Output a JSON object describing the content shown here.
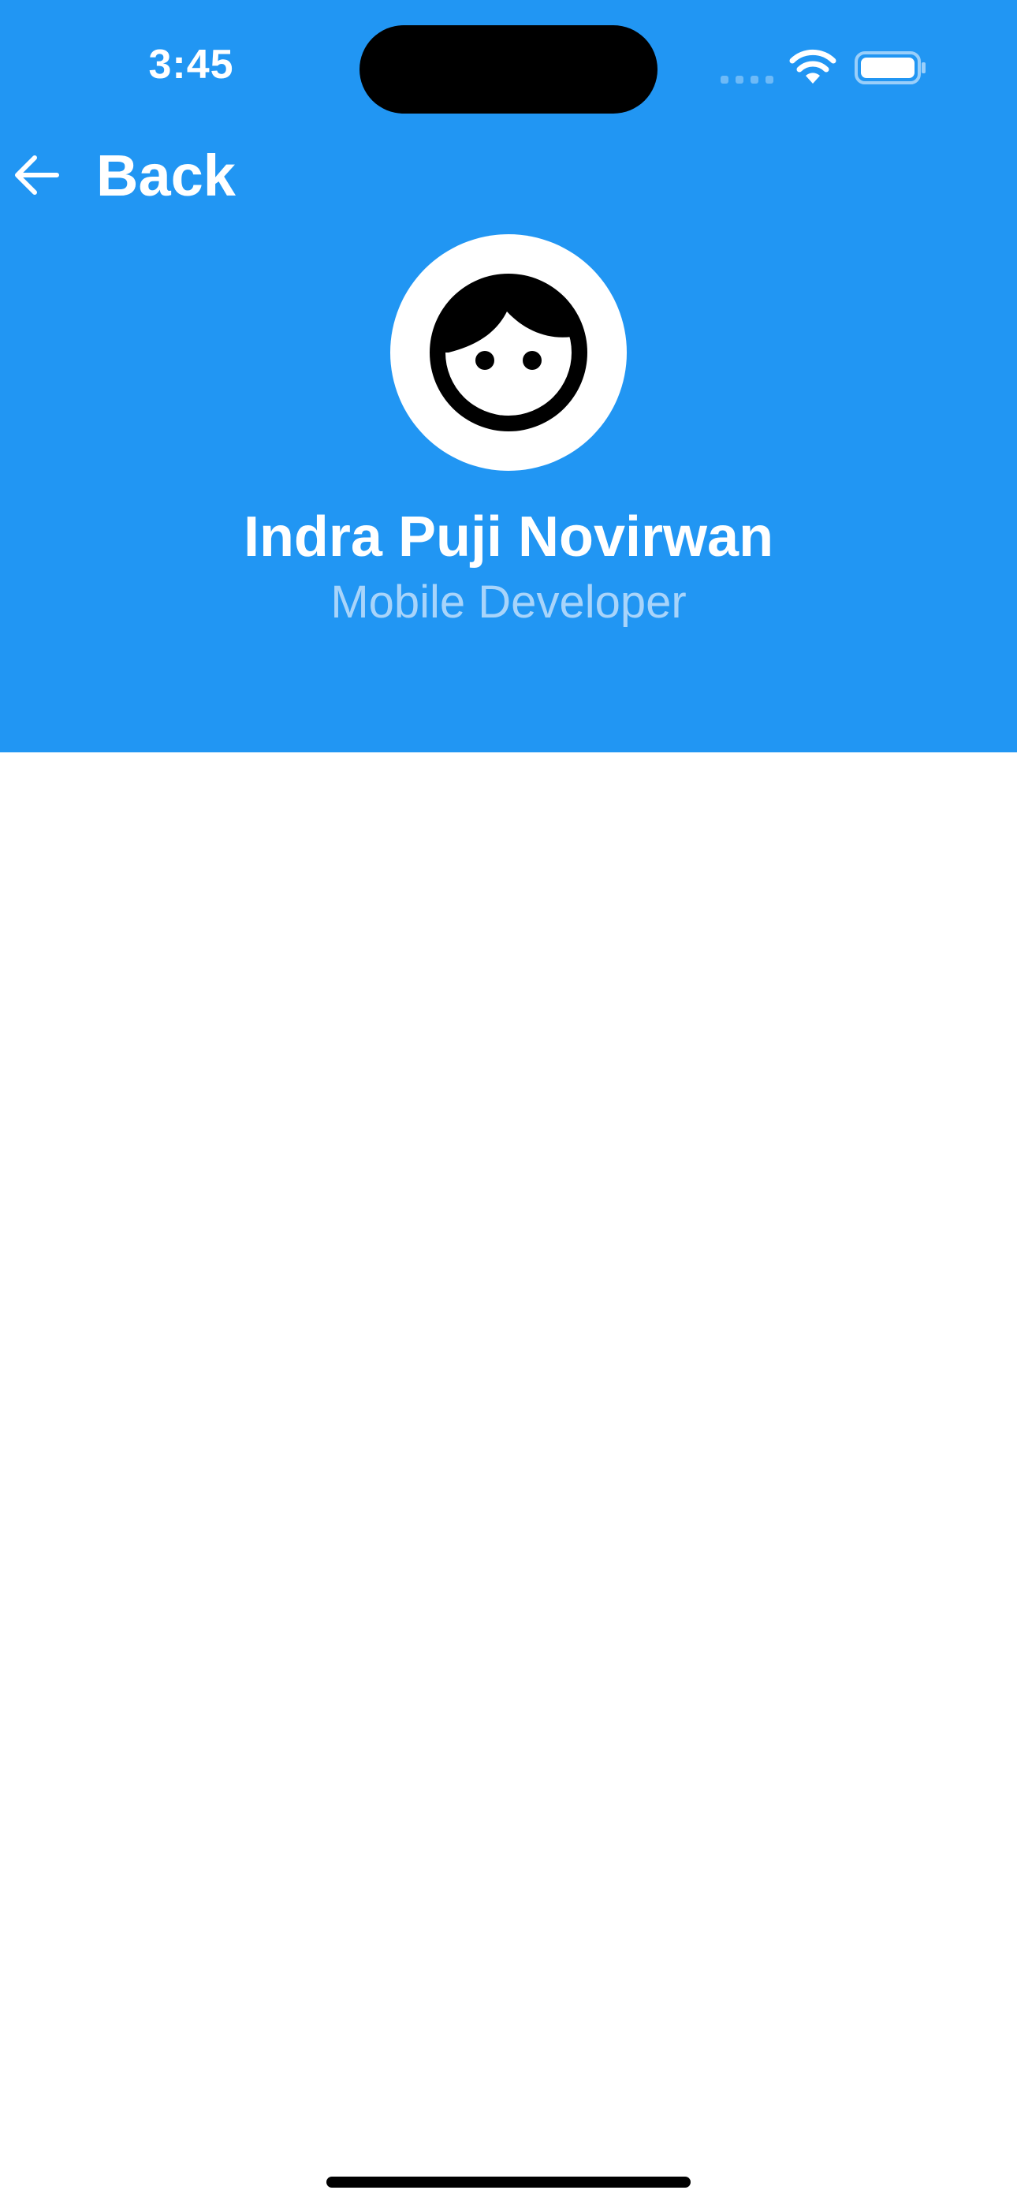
{
  "status_bar": {
    "time": "3:45",
    "wifi_icon": "wifi-icon",
    "battery_icon": "battery-icon"
  },
  "navigation": {
    "back_label": "Back",
    "back_icon": "arrow-left-icon"
  },
  "profile": {
    "avatar_icon": "face-icon",
    "name": "Indra Puji Novirwan",
    "role": "Mobile Developer"
  },
  "colors": {
    "header_background": "#2196F3",
    "name_text": "#FFFFFF",
    "role_text": "#A8D4FA",
    "page_background": "#FFFFFF"
  }
}
